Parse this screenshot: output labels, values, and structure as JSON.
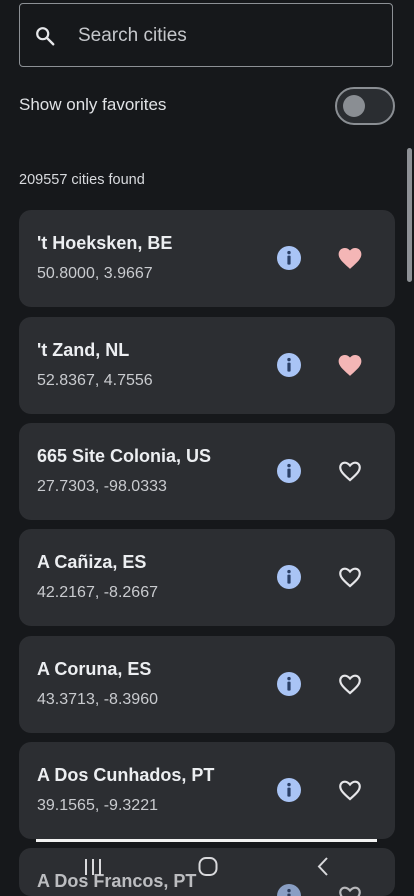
{
  "search": {
    "placeholder": "Search cities",
    "value": ""
  },
  "favorites_filter": {
    "label": "Show only favorites",
    "enabled": false
  },
  "results": {
    "count_text": "209557 cities found"
  },
  "cities": [
    {
      "name": "'t Hoeksken, BE",
      "coords": "50.8000, 3.9667",
      "favorite": true
    },
    {
      "name": "'t Zand, NL",
      "coords": "52.8367, 4.7556",
      "favorite": true
    },
    {
      "name": "665 Site Colonia, US",
      "coords": "27.7303, -98.0333",
      "favorite": false
    },
    {
      "name": "A Cañiza, ES",
      "coords": "42.2167, -8.2667",
      "favorite": false
    },
    {
      "name": "A Coruna, ES",
      "coords": "43.3713, -8.3960",
      "favorite": false
    },
    {
      "name": "A Dos Cunhados, PT",
      "coords": "39.1565, -9.3221",
      "favorite": false
    },
    {
      "name": "A Dos Francos, PT",
      "coords": "",
      "favorite": false
    }
  ],
  "icons": {
    "search": "search-icon",
    "info": "info-icon",
    "favorite": "heart-icon",
    "nav_recents": "recents-icon",
    "nav_home": "home-icon",
    "nav_back": "back-icon"
  },
  "colors": {
    "background": "#16181b",
    "card": "#2c2e32",
    "info_accent": "#a9c4f5",
    "favorite_filled": "#f4b6b6",
    "favorite_outline": "#e6e6e9"
  }
}
